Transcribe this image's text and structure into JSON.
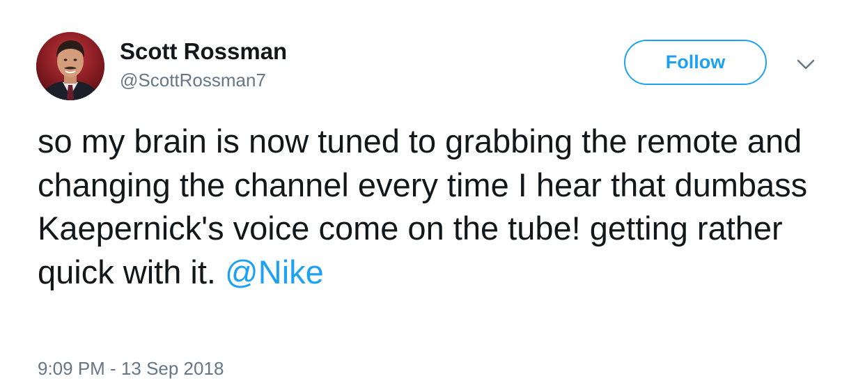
{
  "user": {
    "display_name": "Scott Rossman",
    "handle": "@ScottRossman7"
  },
  "actions": {
    "follow_label": "Follow",
    "menu_icon": "chevron-down-icon"
  },
  "tweet": {
    "text": "so my brain is now tuned to grabbing the remote and changing the channel every time I hear that dumbass Kaepernick's voice come on the tube! getting rather quick with it. ",
    "mention": "@Nike",
    "timestamp": "9:09 PM - 13 Sep 2018"
  },
  "colors": {
    "accent": "#1da1f2",
    "text": "#14171a",
    "secondary_text": "#657786"
  }
}
